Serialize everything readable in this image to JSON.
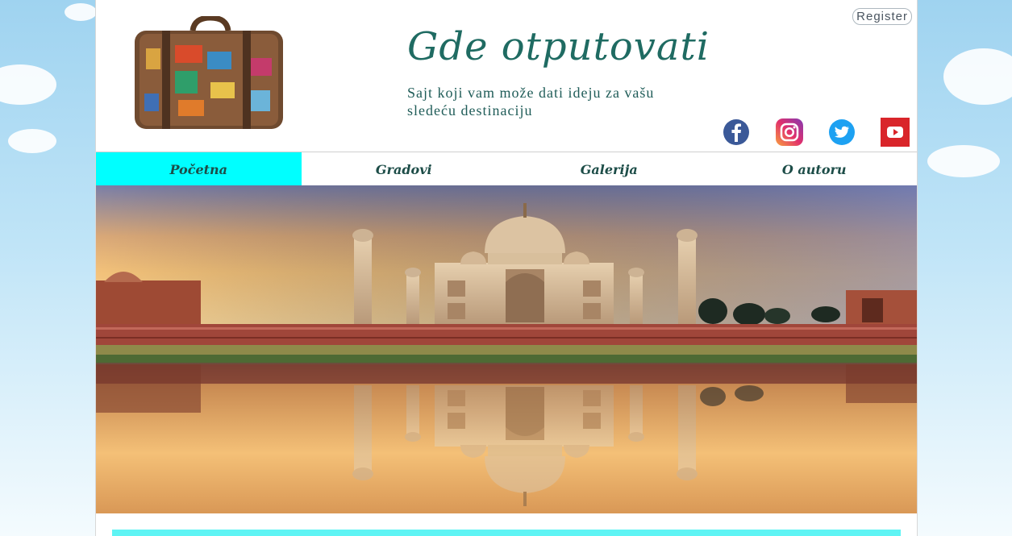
{
  "site": {
    "title": "Gde otputovati",
    "subtitle": "Sajt koji vam može dati ideju za vašu sledeću destinaciju",
    "register_label": "Register"
  },
  "social": [
    "facebook-icon",
    "instagram-icon",
    "twitter-icon",
    "youtube-icon"
  ],
  "nav": {
    "items": [
      {
        "label": "Početna",
        "active": true
      },
      {
        "label": "Gradovi",
        "active": false
      },
      {
        "label": "Galerija",
        "active": false
      },
      {
        "label": "O autoru",
        "active": false
      }
    ]
  },
  "colors": {
    "nav_active": "#00ffff",
    "title": "#1f6b62",
    "accent_strip": "#5ff4f4"
  }
}
